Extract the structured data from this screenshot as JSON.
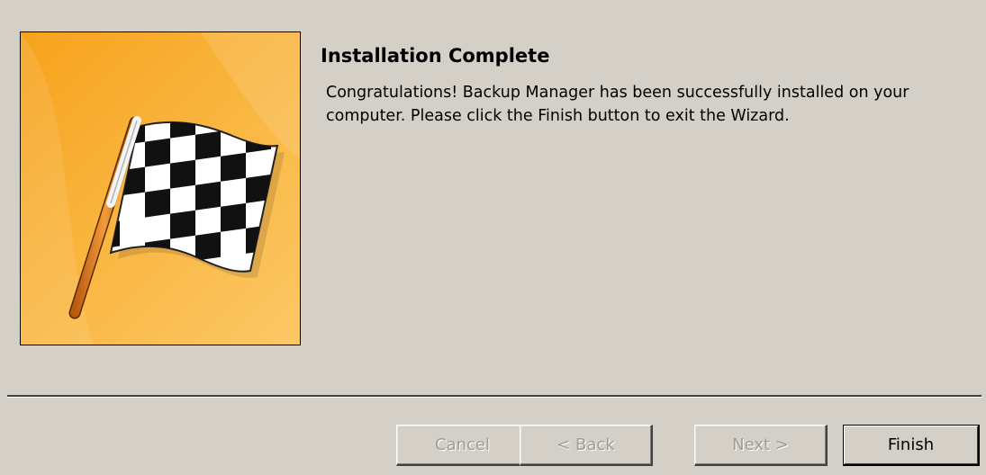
{
  "wizard": {
    "title": "Installation Complete",
    "message": "Congratulations! Backup Manager has been successfully installed on your computer. Please click the Finish button to exit the Wizard.",
    "banner_icon": "checkered-flag-icon"
  },
  "buttons": {
    "cancel": {
      "label": "Cancel",
      "enabled": false
    },
    "back": {
      "label": "< Back",
      "enabled": false
    },
    "next": {
      "label": "Next >",
      "enabled": false
    },
    "finish": {
      "label": "Finish",
      "enabled": true
    }
  },
  "colors": {
    "dialog_bg": "#d4d0c8",
    "banner_orange": "#f9b43d",
    "disabled_text": "#a09c94"
  }
}
